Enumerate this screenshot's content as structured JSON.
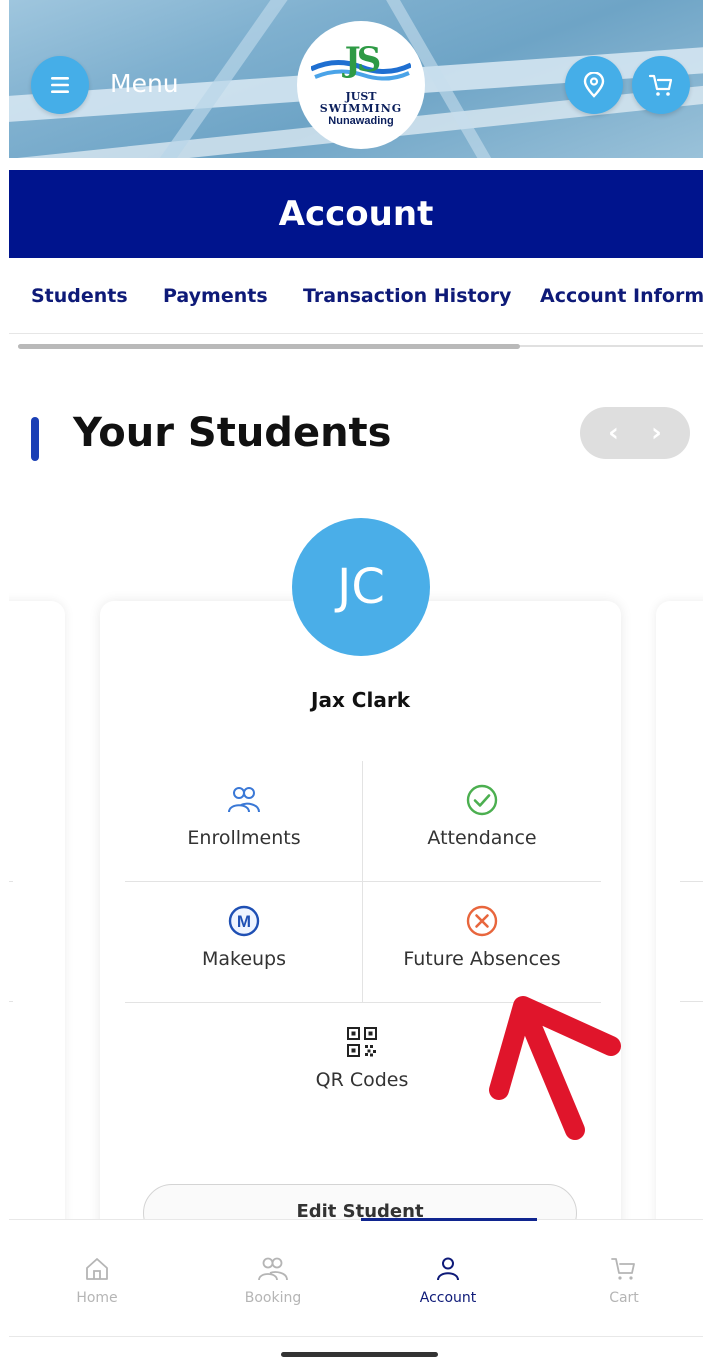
{
  "header": {
    "menu_label": "Menu",
    "logo": {
      "monogram": "JS",
      "line1": "JUST",
      "line2": "SWIMMING",
      "line3": "Nunawading"
    },
    "icons": {
      "menu": "hamburger-icon",
      "location": "map-pin-icon",
      "cart": "cart-icon"
    }
  },
  "title_bar": {
    "title": "Account"
  },
  "tabs": [
    {
      "label": "Students"
    },
    {
      "label": "Payments"
    },
    {
      "label": "Transaction History"
    },
    {
      "label": "Account Informa"
    }
  ],
  "section": {
    "title": "Your Students"
  },
  "student": {
    "initials": "JC",
    "name": "Jax Clark",
    "actions": [
      {
        "label": "Enrollments",
        "icon": "users-icon"
      },
      {
        "label": "Attendance",
        "icon": "check-circle-icon"
      },
      {
        "label": "Makeups",
        "icon": "makeup-m-icon"
      },
      {
        "label": "Future Absences",
        "icon": "x-circle-icon"
      },
      {
        "label": "QR Codes",
        "icon": "qr-code-icon"
      }
    ],
    "edit_label": "Edit Student"
  },
  "bottom_nav": [
    {
      "label": "Home",
      "icon": "home-icon"
    },
    {
      "label": "Booking",
      "icon": "users-icon"
    },
    {
      "label": "Account",
      "icon": "user-icon"
    },
    {
      "label": "Cart",
      "icon": "cart-icon"
    }
  ],
  "colors": {
    "brand_navy": "#00148d",
    "accent_blue": "#45aee8",
    "tab_text": "#0e1a78",
    "annotation_red": "#e0152b",
    "success_green": "#4caf50",
    "danger_orange": "#e8663d"
  }
}
